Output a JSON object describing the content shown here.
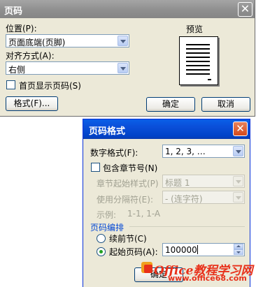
{
  "back_dialog": {
    "title": "页码",
    "position_label": "位置(P):",
    "position_value": "页面底端(页脚)",
    "alignment_label": "对齐方式(A):",
    "alignment_value": "右侧",
    "first_page_label": "首页显示页码(S)",
    "preview_label": "预览",
    "format_button": "格式(F)...",
    "ok_button": "确定",
    "cancel_button": "取消"
  },
  "front_dialog": {
    "title": "页码格式",
    "number_format_label": "数字格式(F):",
    "number_format_value": "1, 2, 3, …",
    "include_chapter_label": "包含章节号(N)",
    "chapter_style_label": "章节起始样式(P)",
    "chapter_style_value": "标题 1",
    "separator_label": "使用分隔符(E):",
    "separator_value": "-  (连字符)",
    "example_label": "示例:",
    "example_value": "1-1, 1-A",
    "numbering_group": "页码编排",
    "continue_label": "续前节(C)",
    "start_at_label": "起始页码(A):",
    "start_at_value": "100000",
    "ok_button": "确定"
  },
  "watermark": {
    "text": "Office教程学习网",
    "url": "www.office68.com",
    "color": "#e8301a"
  }
}
